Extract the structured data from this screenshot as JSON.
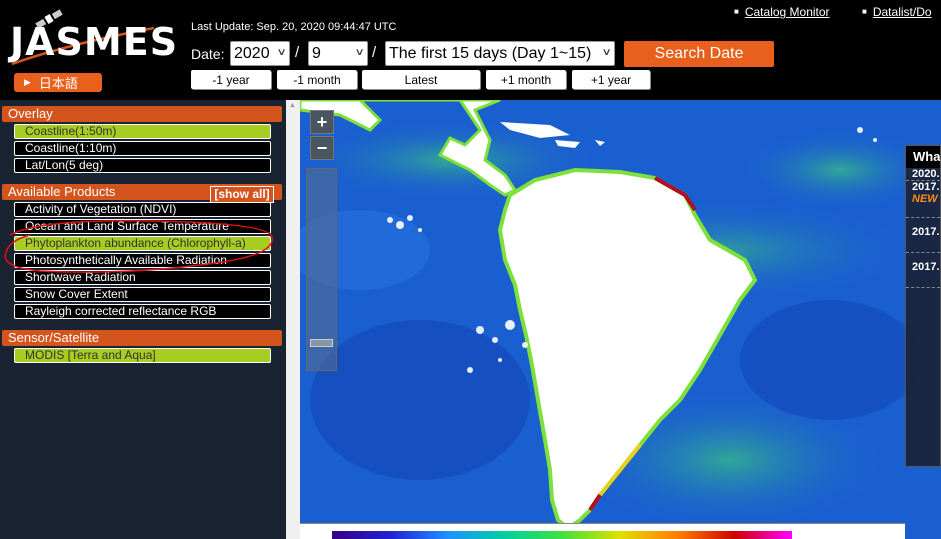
{
  "app": {
    "logo_text": "JASMES",
    "lang_button": "日本語",
    "last_update": "Last Update: Sep. 20, 2020 09:44:47 UTC"
  },
  "nav": {
    "links": [
      "Catalog Monitor",
      "Datalist/Do"
    ]
  },
  "date": {
    "label": "Date:",
    "year": "2020",
    "month": "9",
    "period": "The first 15 days (Day 1~15)",
    "search_label": "Search Date",
    "steps": [
      "-1 year",
      "-1 month",
      "Latest",
      "+1 month",
      "+1 year"
    ]
  },
  "sidebar": {
    "overlay_title": "Overlay",
    "overlay_items": [
      {
        "label": "Coastline(1:50m)",
        "active": true
      },
      {
        "label": "Coastline(1:10m)",
        "active": false
      },
      {
        "label": "Lat/Lon(5 deg)",
        "active": false
      }
    ],
    "products_title": "Available Products",
    "show_all": "[show all]",
    "product_items": [
      {
        "label": "Activity of Vegetation (NDVI)",
        "active": false
      },
      {
        "label": "Ocean and Land Surface Temperature",
        "active": false
      },
      {
        "label": "Phytoplankton abundance (Chlorophyll-a)",
        "active": true
      },
      {
        "label": "Photosynthetically Available Radiation",
        "active": false
      },
      {
        "label": "Shortwave Radiation",
        "active": false
      },
      {
        "label": "Snow Cover Extent",
        "active": false
      },
      {
        "label": "Rayleigh corrected reflectance RGB",
        "active": false
      }
    ],
    "sensor_title": "Sensor/Satellite",
    "sensor_items": [
      {
        "label": "MODIS [Terra and Aqua]",
        "active": true
      }
    ]
  },
  "map": {
    "zoom_in": "+",
    "zoom_out": "−",
    "news_title": "Wha",
    "news_items": [
      "2020.",
      "2017.",
      "2017.",
      "2017."
    ],
    "news_new": "NEW"
  },
  "colors": {
    "accent": "#e8601c",
    "active_item": "#a6cd1f",
    "ocean_low": "#1a5fd0",
    "ocean_high": "#30d060"
  }
}
